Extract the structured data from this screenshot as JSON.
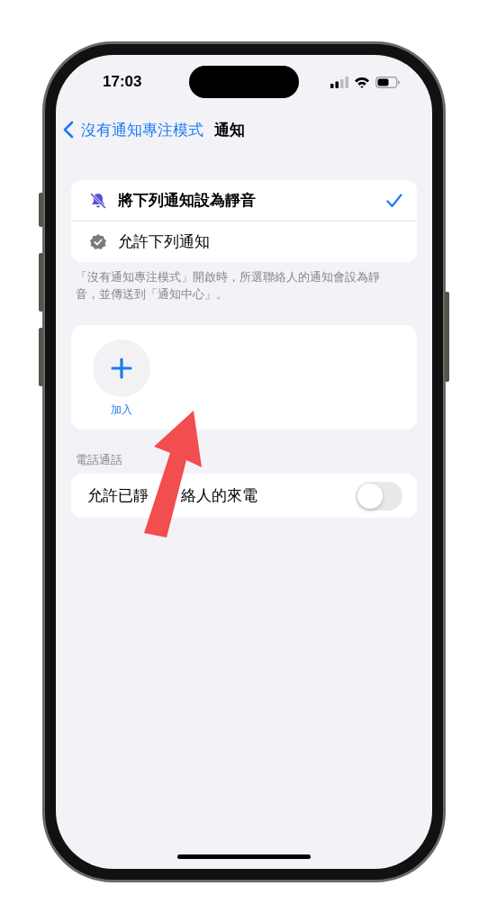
{
  "status_bar": {
    "time": "17:03"
  },
  "nav": {
    "back": "沒有通知專注模式",
    "title": "通知"
  },
  "mode_options": [
    {
      "label": "將下列通知設為靜音",
      "selected": true
    },
    {
      "label": "允許下列通知",
      "selected": false
    }
  ],
  "footnote": "「沒有通知專注模式」開啟時，所選聯絡人的通知會設為靜音，並傳送到「通知中心」。",
  "add_button": {
    "label": "加入"
  },
  "calls_section": {
    "header": "電話通話",
    "row": {
      "label_parts": [
        "允許已靜",
        "絡人的來電"
      ],
      "on": false
    }
  },
  "annotation": {
    "kind": "arrow"
  }
}
